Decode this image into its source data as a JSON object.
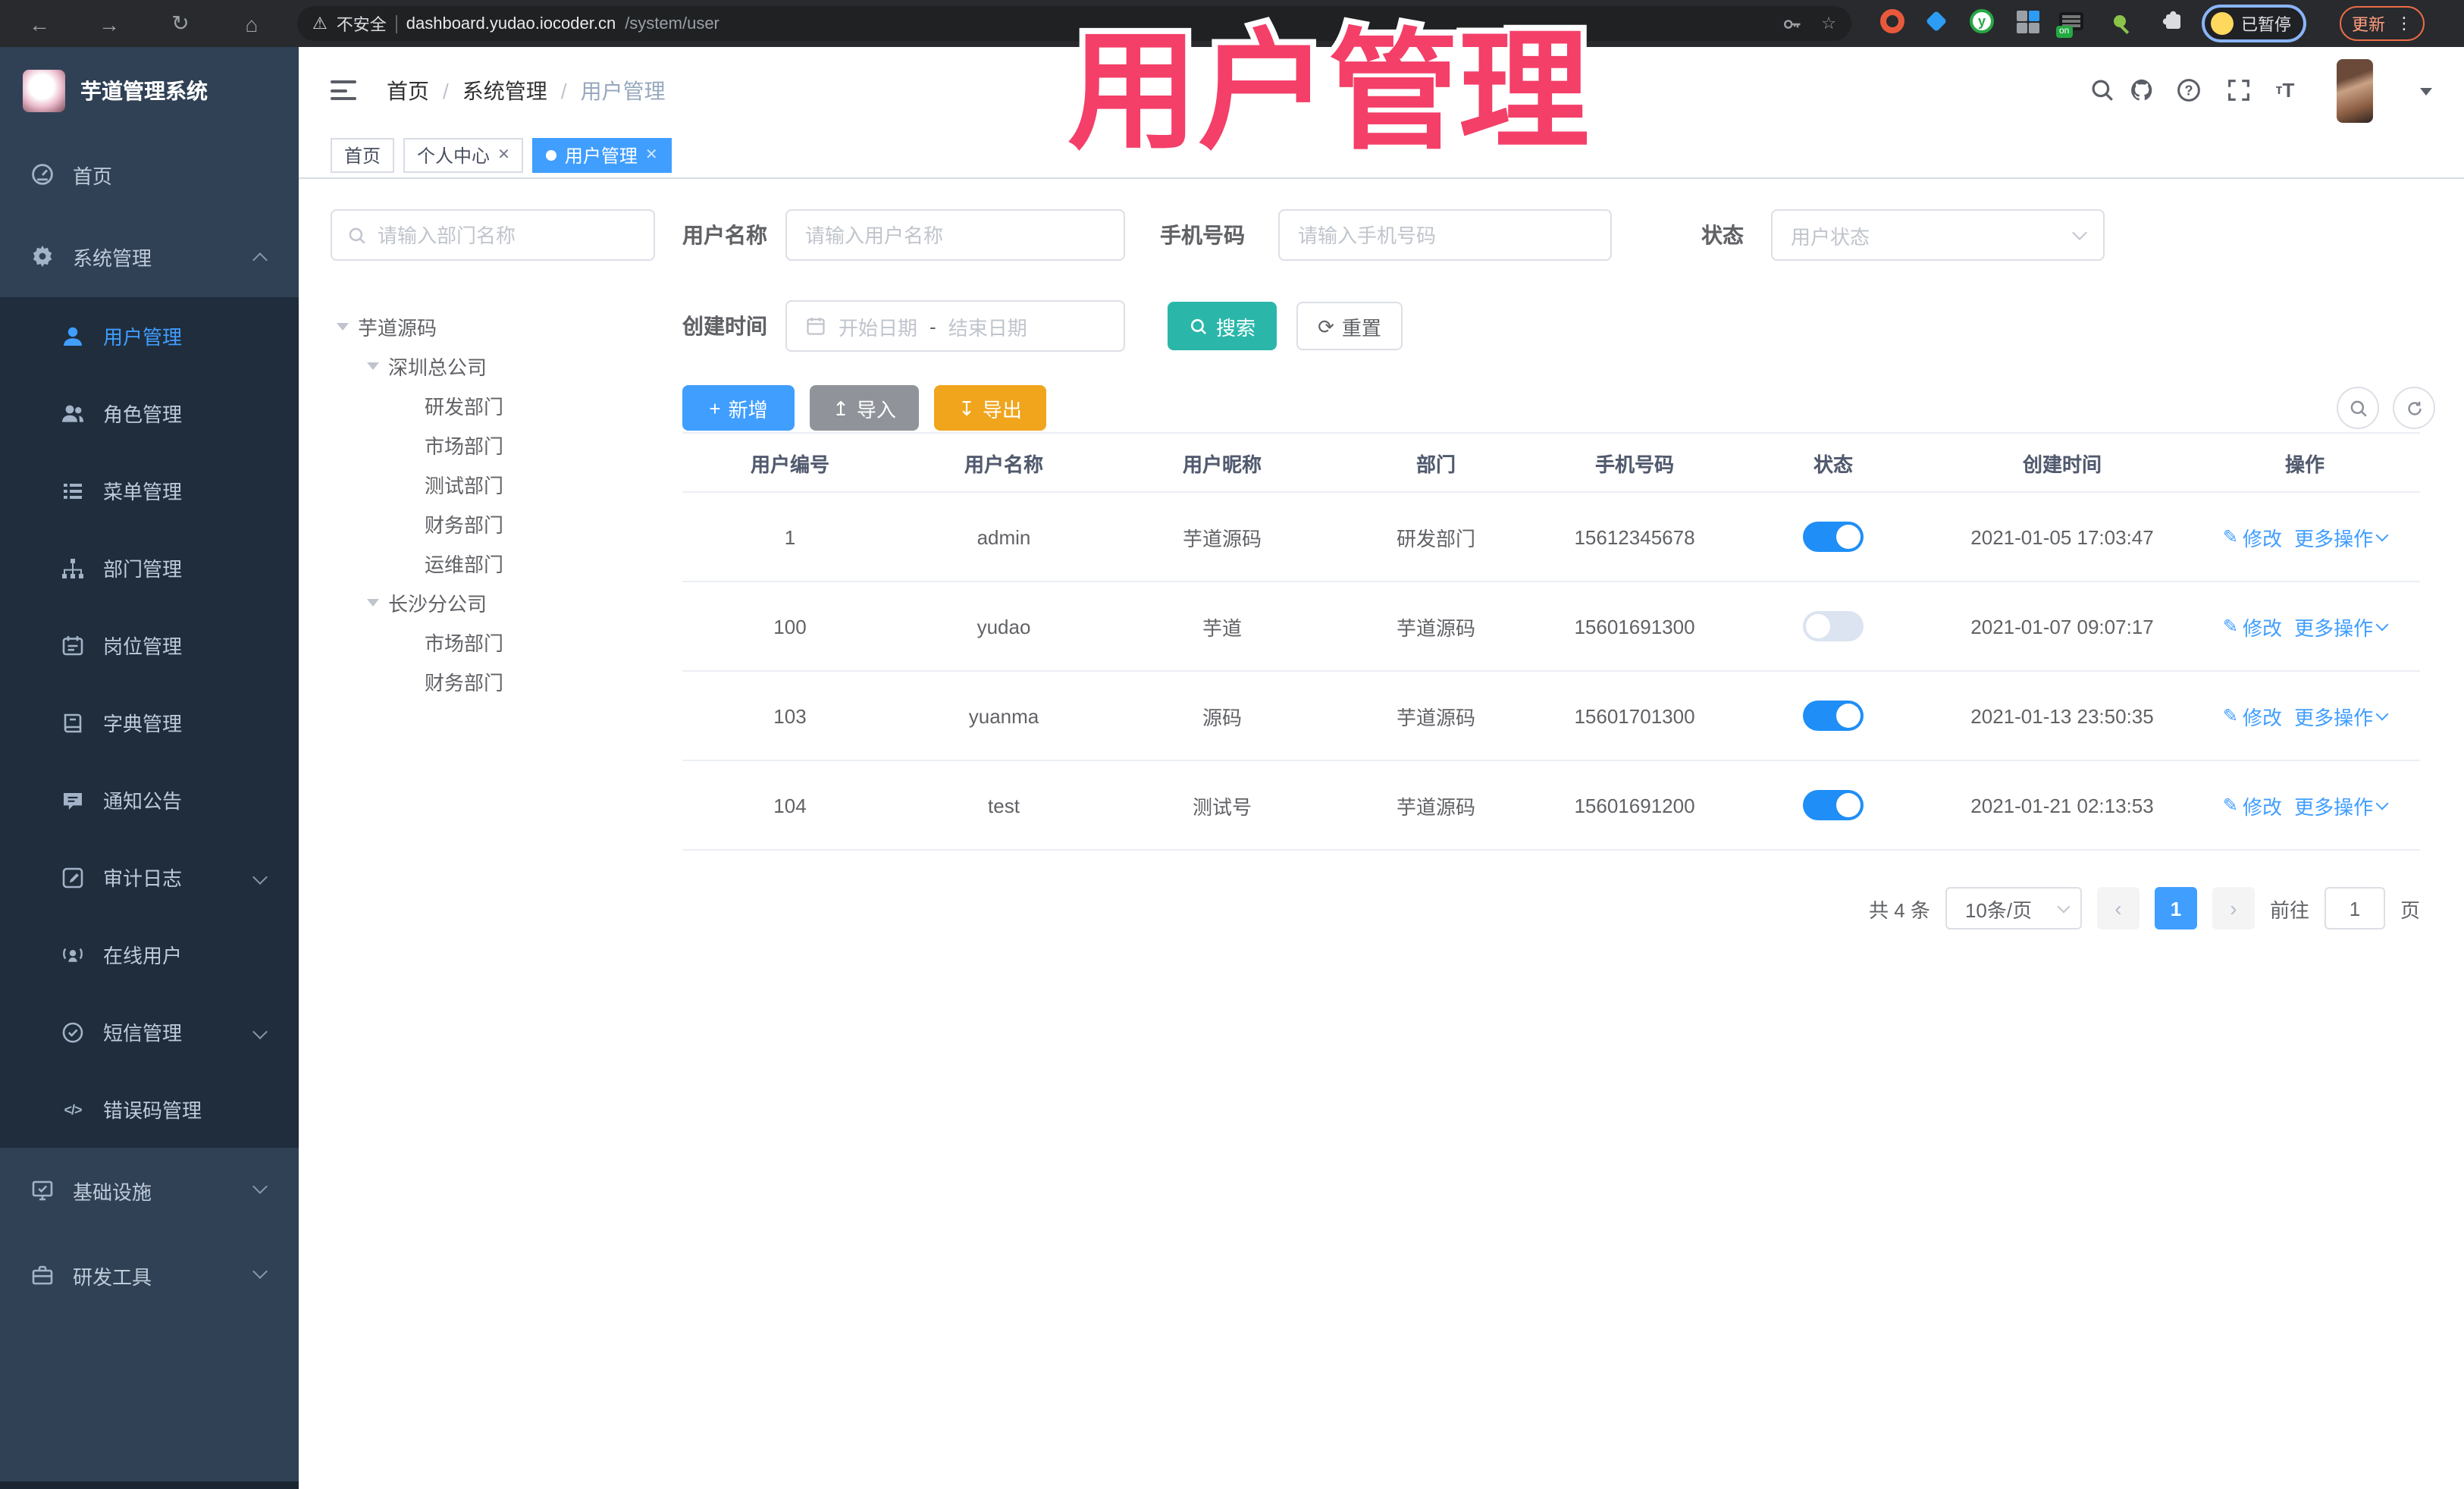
{
  "watermark": "用户管理",
  "colors": {
    "accent": "#409eff",
    "search_teal": "#2ab7a9",
    "export_warning": "#f0a51d",
    "import_info": "#909399",
    "watermark_pink": "#f43f68",
    "sidebar_bg": "#304156",
    "submenu_bg": "#1f2d3d"
  },
  "browser": {
    "security_label": "不安全",
    "url_host": "dashboard.yudao.iocoder.cn",
    "url_path": "/system/user",
    "profile_status": "已暂停",
    "update_label": "更新"
  },
  "sidebar": {
    "app_title": "芋道管理系统",
    "items": [
      {
        "label": "首页"
      },
      {
        "label": "系统管理"
      },
      {
        "label": "用户管理"
      },
      {
        "label": "角色管理"
      },
      {
        "label": "菜单管理"
      },
      {
        "label": "部门管理"
      },
      {
        "label": "岗位管理"
      },
      {
        "label": "字典管理"
      },
      {
        "label": "通知公告"
      },
      {
        "label": "审计日志"
      },
      {
        "label": "在线用户"
      },
      {
        "label": "短信管理"
      },
      {
        "label": "错误码管理"
      },
      {
        "label": "基础设施"
      },
      {
        "label": "研发工具"
      }
    ]
  },
  "header": {
    "breadcrumb": [
      "首页",
      "系统管理",
      "用户管理"
    ],
    "separator": "/"
  },
  "tabs": [
    {
      "label": "首页"
    },
    {
      "label": "个人中心"
    },
    {
      "label": "用户管理"
    }
  ],
  "dept": {
    "search_placeholder": "请输入部门名称",
    "tree": [
      {
        "label": "芋道源码"
      },
      {
        "label": "深圳总公司"
      },
      {
        "label": "研发部门"
      },
      {
        "label": "市场部门"
      },
      {
        "label": "测试部门"
      },
      {
        "label": "财务部门"
      },
      {
        "label": "运维部门"
      },
      {
        "label": "长沙分公司"
      },
      {
        "label": "市场部门"
      },
      {
        "label": "财务部门"
      }
    ]
  },
  "filters": {
    "username_label": "用户名称",
    "username_placeholder": "请输入用户名称",
    "mobile_label": "手机号码",
    "mobile_placeholder": "请输入手机号码",
    "status_label": "状态",
    "status_placeholder": "用户状态",
    "time_label": "创建时间",
    "date_start": "开始日期",
    "date_separator": "-",
    "date_end": "结束日期",
    "search_label": "搜索",
    "reset_label": "重置"
  },
  "toolbar": {
    "add_label": "新增",
    "import_label": "导入",
    "export_label": "导出"
  },
  "table": {
    "columns": [
      "用户编号",
      "用户名称",
      "用户昵称",
      "部门",
      "手机号码",
      "状态",
      "创建时间",
      "操作"
    ],
    "action_edit": "修改",
    "action_more": "更多操作",
    "rows": [
      {
        "id": "1",
        "username": "admin",
        "nickname": "芋道源码",
        "dept": "研发部门",
        "mobile": "15612345678",
        "status": true,
        "created": "2021-01-05 17:03:47"
      },
      {
        "id": "100",
        "username": "yudao",
        "nickname": "芋道",
        "dept": "芋道源码",
        "mobile": "15601691300",
        "status": false,
        "created": "2021-01-07 09:07:17"
      },
      {
        "id": "103",
        "username": "yuanma",
        "nickname": "源码",
        "dept": "芋道源码",
        "mobile": "15601701300",
        "status": true,
        "created": "2021-01-13 23:50:35"
      },
      {
        "id": "104",
        "username": "test",
        "nickname": "测试号",
        "dept": "芋道源码",
        "mobile": "15601691200",
        "status": true,
        "created": "2021-01-21 02:13:53"
      }
    ]
  },
  "pagination": {
    "total": "共 4 条",
    "page_size": "10条/页",
    "current_page": "1",
    "goto_label": "前往",
    "goto_value": "1",
    "unit_label": "页"
  }
}
